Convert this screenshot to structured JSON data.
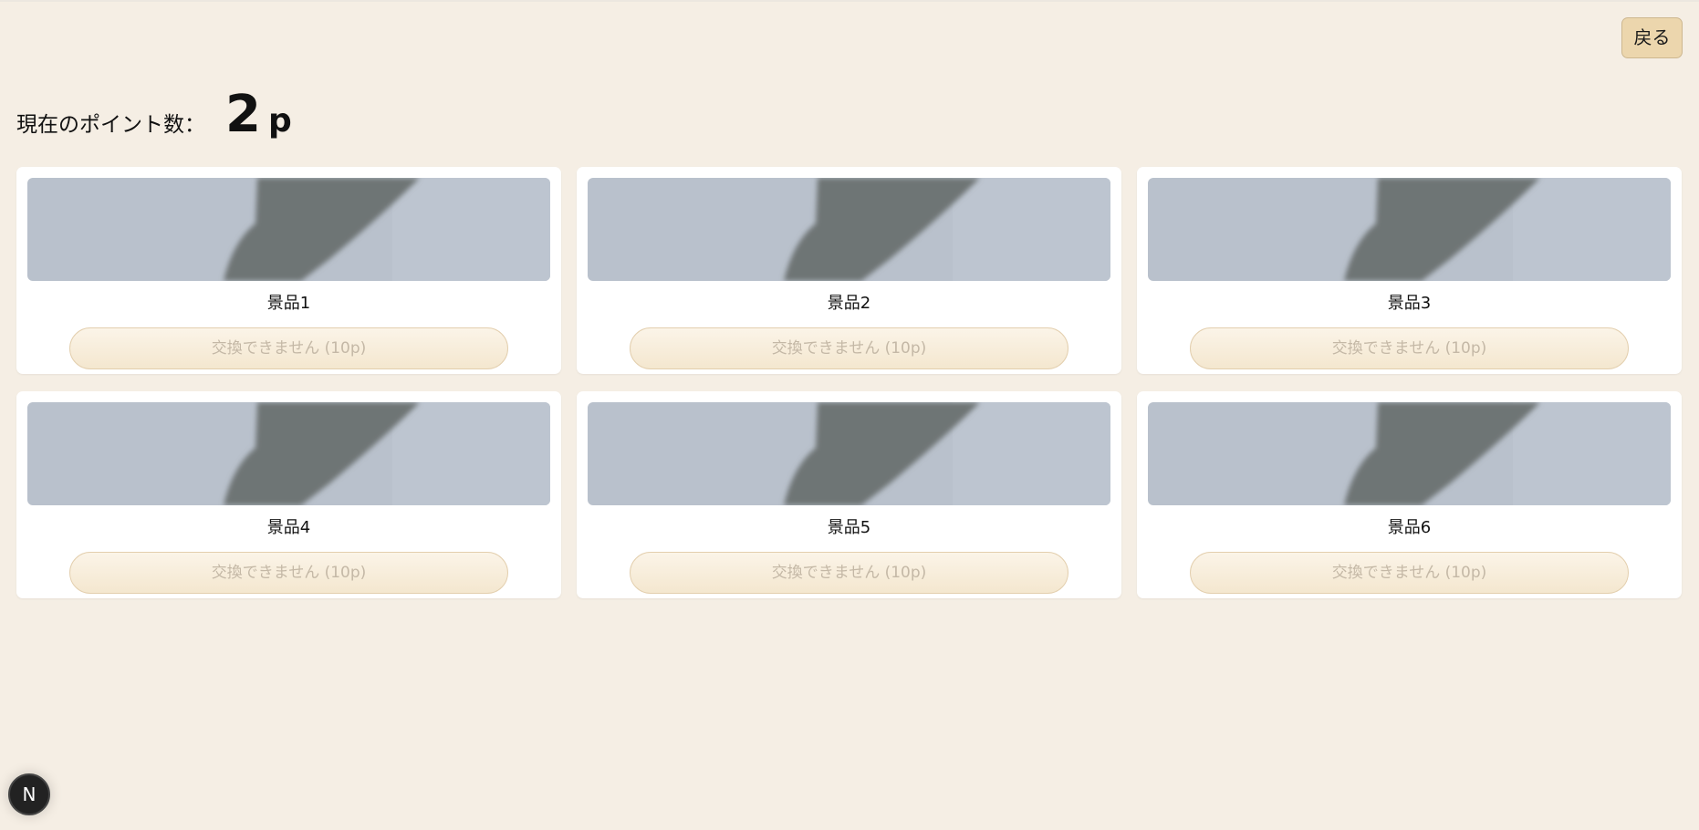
{
  "header": {
    "back_label": "戻る"
  },
  "points": {
    "label": "現在のポイント数：",
    "value": "2",
    "unit": "p"
  },
  "prizes": [
    {
      "name": "景品1",
      "button_label": "交換できません (10p)"
    },
    {
      "name": "景品2",
      "button_label": "交換できません (10p)"
    },
    {
      "name": "景品3",
      "button_label": "交換できません (10p)"
    },
    {
      "name": "景品4",
      "button_label": "交換できません (10p)"
    },
    {
      "name": "景品5",
      "button_label": "交換できません (10p)"
    },
    {
      "name": "景品6",
      "button_label": "交換できません (10p)"
    }
  ],
  "dev_badge": {
    "letter": "N"
  },
  "colors": {
    "background": "#f5eee4",
    "accent": "#ecd6ad",
    "disabled_button": "#f6ebd8",
    "disabled_text": "#c4b8a6"
  }
}
